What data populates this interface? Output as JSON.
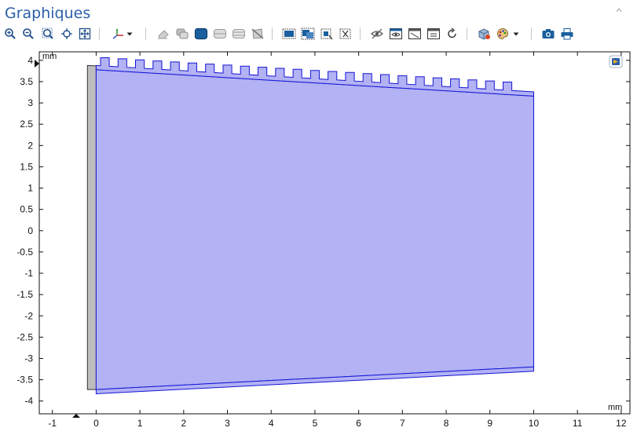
{
  "window": {
    "title": "Graphiques"
  },
  "toolbar": {
    "buttons": [
      {
        "icon": "zoom-in-icon"
      },
      {
        "icon": "zoom-out-icon"
      },
      {
        "icon": "zoom-box-icon"
      },
      {
        "icon": "center-icon"
      },
      {
        "icon": "zoom-extents-icon"
      },
      {
        "icon": "axis-orientation-icon"
      },
      {
        "icon": "dropdown-icon"
      },
      {
        "icon": "erase-icon"
      },
      {
        "icon": "transparency-icon"
      },
      {
        "icon": "render-solid-icon"
      },
      {
        "icon": "wireframe-icon"
      },
      {
        "icon": "wireframe-alt-icon"
      },
      {
        "icon": "hide-selection-icon"
      },
      {
        "icon": "select-box-icon"
      },
      {
        "icon": "select-all-icon"
      },
      {
        "icon": "select-inverse-icon"
      },
      {
        "icon": "clear-selection-icon"
      },
      {
        "icon": "visibility-icon"
      },
      {
        "icon": "view-active-icon"
      },
      {
        "icon": "view-list-icon"
      },
      {
        "icon": "view-settings-icon"
      },
      {
        "icon": "reset-icon"
      },
      {
        "icon": "scene-light-icon"
      },
      {
        "icon": "colors-icon"
      },
      {
        "icon": "dropdown-icon"
      },
      {
        "icon": "camera-icon"
      },
      {
        "icon": "print-icon"
      }
    ]
  },
  "plot": {
    "y_unit": "mm",
    "x_unit": "mm",
    "y_ticks": [
      "4",
      "3.5",
      "3",
      "2.5",
      "2",
      "1.5",
      "1",
      "0.5",
      "0",
      "-0.5",
      "-1",
      "-1.5",
      "-2",
      "-2.5",
      "-3",
      "-3.5",
      "-4"
    ],
    "x_ticks": [
      "-1",
      "0",
      "1",
      "2",
      "3",
      "4",
      "5",
      "6",
      "7",
      "8",
      "9",
      "10",
      "11",
      "12"
    ],
    "x_range": [
      -1.3,
      12.2
    ],
    "y_range": [
      -4.3,
      4.2
    ],
    "colors": {
      "domain_fill": "#b2b2f4",
      "domain_edge": "#1616d6",
      "wall_fill": "#bdbdbd",
      "wall_edge": "#333333"
    }
  }
}
